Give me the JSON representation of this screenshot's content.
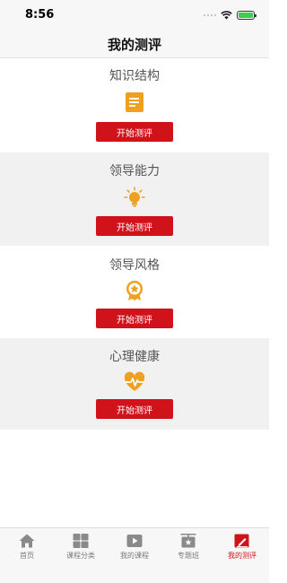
{
  "status_bar": {
    "time": "8:56"
  },
  "header": {
    "title": "我的测评"
  },
  "sections": [
    {
      "title": "知识结构",
      "icon": "document-icon",
      "button_label": "开始测评"
    },
    {
      "title": "领导能力",
      "icon": "lightbulb-icon",
      "button_label": "开始测评"
    },
    {
      "title": "领导风格",
      "icon": "badge-star-icon",
      "button_label": "开始测评"
    },
    {
      "title": "心理健康",
      "icon": "heart-pulse-icon",
      "button_label": "开始测评"
    }
  ],
  "tab_bar": {
    "active_index": 4,
    "items": [
      {
        "label": "首页",
        "icon": "home-icon"
      },
      {
        "label": "课程分类",
        "icon": "grid-icon"
      },
      {
        "label": "我的课程",
        "icon": "play-icon"
      },
      {
        "label": "专题班",
        "icon": "board-star-icon"
      },
      {
        "label": "我的测评",
        "icon": "evaluation-icon"
      }
    ]
  },
  "colors": {
    "accent": "#d0121b",
    "icon_orange": "#f0a020",
    "section_gray": "#f1f1f1",
    "tab_inactive": "#7a7a7a"
  }
}
